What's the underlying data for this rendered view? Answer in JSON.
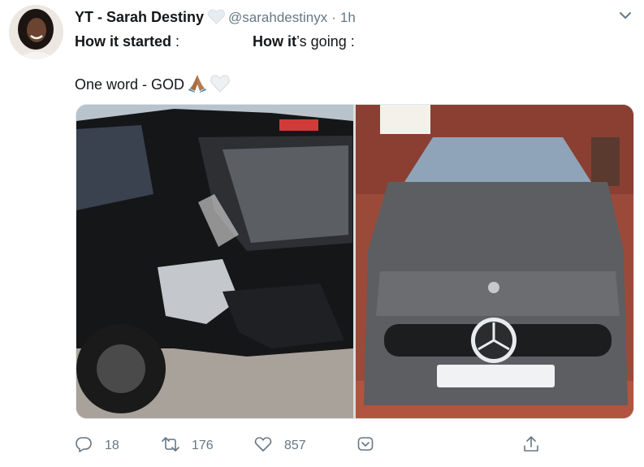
{
  "tweet": {
    "display_name": "YT - Sarah Destiny",
    "handle": "@sarahdestinyx",
    "separator": "·",
    "time": "1h",
    "line1_left_bold": "How it",
    "line1_left_rest": " started",
    "line1_left_colon": " :",
    "line1_right_bold": "How it",
    "line1_right_rest": "’s going",
    "line1_right_colon": " :",
    "line2": "One word - GOD",
    "images": [
      {
        "icon": "crashed-car-photo"
      },
      {
        "icon": "new-mercedes-photo"
      }
    ]
  },
  "actions": {
    "reply_count": "18",
    "retweet_count": "176",
    "like_count": "857"
  },
  "colors": {
    "text": "#14171a",
    "muted": "#657786",
    "border": "#e1e8ed"
  }
}
